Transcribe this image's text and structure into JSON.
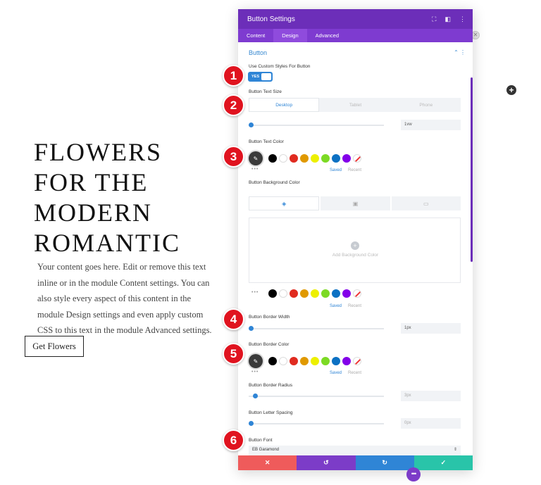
{
  "page": {
    "title_lines": "FLOWERS\nFOR THE\nMODERN\nROMANTIC",
    "body_text": "Your content goes here. Edit or remove this text inline or in the module Content settings. You can also style every aspect of this content in the module Design settings and even apply custom CSS to this text in the module Advanced settings.",
    "button_label": "Get Flowers"
  },
  "modal": {
    "title": "Button Settings",
    "tabs": [
      "Content",
      "Design",
      "Advanced"
    ],
    "active_tab": "Design",
    "section_title": "Button",
    "use_custom_label": "Use Custom Styles For Button",
    "toggle_value": "YES",
    "text_size_label": "Button Text Size",
    "device_tabs": [
      "Desktop",
      "Tablet",
      "Phone"
    ],
    "text_size_value": "1vw",
    "text_color_label": "Button Text Color",
    "saved": "Saved",
    "recent": "Recent",
    "bg_color_label": "Button Background Color",
    "add_bg_color": "Add Background Color",
    "border_width_label": "Button Border Width",
    "border_width_value": "1px",
    "border_color_label": "Button Border Color",
    "border_radius_label": "Button Border Radius",
    "border_radius_value": "3px",
    "letter_spacing_label": "Button Letter Spacing",
    "letter_spacing_value": "0px",
    "font_label": "Button Font",
    "font_value": "EB Garamond",
    "palette": [
      "#000000",
      "#ffffff",
      "#e02b20",
      "#e09900",
      "#edf000",
      "#7cda24",
      "#0c71c3",
      "#8300e9"
    ]
  },
  "annotations": [
    "1",
    "2",
    "3",
    "4",
    "5",
    "6"
  ],
  "colors": {
    "header": "#6c2eb9",
    "accent": "#2f85d6",
    "badge": "#e0131f"
  }
}
